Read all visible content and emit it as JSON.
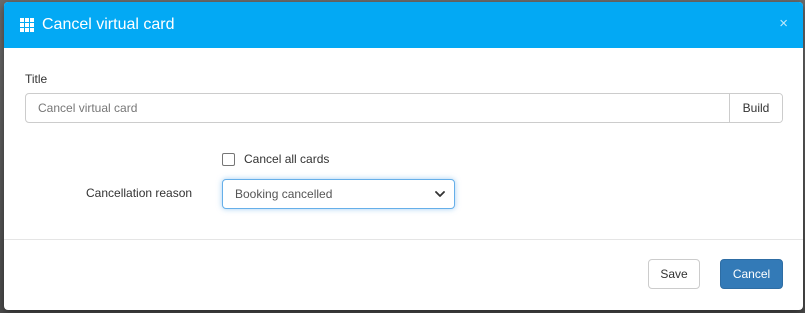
{
  "dialog": {
    "title": "Cancel virtual card",
    "close_symbol": "×",
    "header_icon": "grid-icon",
    "header_color": "#03a9f4"
  },
  "form": {
    "title_label": "Title",
    "title_placeholder": "Cancel virtual card",
    "title_value": "",
    "build_button_label": "Build",
    "cancel_all_label": "Cancel all cards",
    "cancel_all_checked": false,
    "reason_label": "Cancellation reason",
    "reason_selected": "Booking cancelled"
  },
  "footer": {
    "save_label": "Save",
    "cancel_label": "Cancel",
    "primary_color": "#337ab7"
  }
}
